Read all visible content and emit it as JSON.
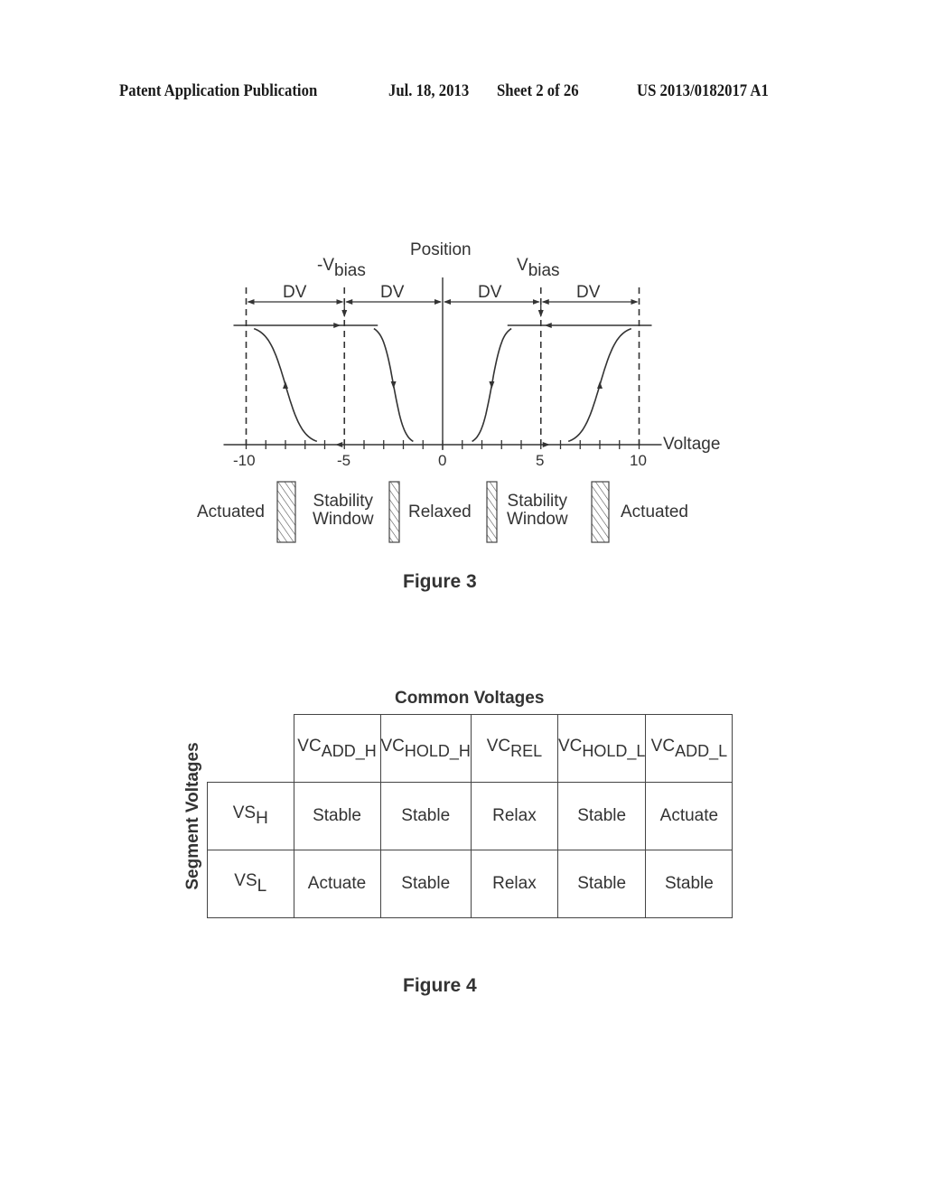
{
  "header": {
    "publication": "Patent Application Publication",
    "date": "Jul. 18, 2013",
    "sheet": "Sheet 2 of 26",
    "number": "US 2013/0182017 A1"
  },
  "figure3": {
    "caption": "Figure 3",
    "chart_data": {
      "type": "line",
      "title": "",
      "xlabel": "Voltage",
      "ylabel": "Position",
      "xlim": [
        -10,
        10
      ],
      "x_tick_labels": [
        "-10",
        "-5",
        "0",
        "5",
        "10"
      ],
      "x_ticks": [
        -10,
        -9,
        -8,
        -7,
        -6,
        -5,
        -4,
        -3,
        -2,
        -1,
        0,
        1,
        2,
        3,
        4,
        5,
        6,
        7,
        8,
        9,
        10
      ],
      "dashed_lines_x": [
        -10,
        -5,
        5,
        10
      ],
      "annotations": {
        "neg_bias": {
          "prefix": "-V",
          "sub": "bias",
          "x": -5
        },
        "pos_bias": {
          "prefix": "V",
          "sub": "bias",
          "x": 5
        },
        "dv_spans": [
          {
            "label": "DV",
            "from": -10,
            "to": -5
          },
          {
            "label": "DV",
            "from": -5,
            "to": 0
          },
          {
            "label": "DV",
            "from": 0,
            "to": 5
          },
          {
            "label": "DV",
            "from": 5,
            "to": 10
          }
        ]
      },
      "series": [
        {
          "name": "negative-actuation",
          "direction": "up",
          "transition_x": -8,
          "from_x": -7,
          "to_x": -9.2,
          "description": "rises from relaxed at about -7 to actuated near -9.5"
        },
        {
          "name": "negative-release",
          "direction": "down",
          "transition_x": -2.5,
          "from_x": -3.3,
          "to_x": -2,
          "description": "falls from actuated near -3.3 to relaxed at about -2"
        },
        {
          "name": "positive-release",
          "direction": "down",
          "transition_x": 2.5,
          "from_x": 3.3,
          "to_x": 2,
          "description": "falls from actuated near 3.3 to relaxed at about 2"
        },
        {
          "name": "positive-actuation",
          "direction": "up",
          "transition_x": 8,
          "from_x": 7,
          "to_x": 9.2,
          "description": "rises from relaxed at about 7 to actuated near 9.5"
        }
      ],
      "levels": {
        "actuated": 1,
        "relaxed": 0
      }
    },
    "regions": [
      {
        "label": "Actuated"
      },
      {
        "label_line1": "Stability",
        "label_line2": "Window"
      },
      {
        "label": "Relaxed"
      },
      {
        "label_line1": "Stability",
        "label_line2": "Window"
      },
      {
        "label": "Actuated"
      }
    ]
  },
  "figure4": {
    "caption": "Figure 4",
    "column_title": "Common Voltages",
    "row_title": "Segment Voltages",
    "columns": [
      {
        "base": "VC",
        "sub": "ADD_H"
      },
      {
        "base": "VC",
        "sub": "HOLD_H"
      },
      {
        "base": "VC",
        "sub": "REL"
      },
      {
        "base": "VC",
        "sub": "HOLD_L"
      },
      {
        "base": "VC",
        "sub": "ADD_L"
      }
    ],
    "rows": [
      {
        "base": "VS",
        "sub": "H",
        "cells": [
          "Stable",
          "Stable",
          "Relax",
          "Stable",
          "Actuate"
        ]
      },
      {
        "base": "VS",
        "sub": "L",
        "cells": [
          "Actuate",
          "Stable",
          "Relax",
          "Stable",
          "Stable"
        ]
      }
    ]
  }
}
